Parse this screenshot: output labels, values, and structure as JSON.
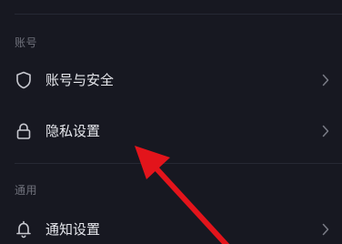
{
  "sections": [
    {
      "header": "账号",
      "items": [
        {
          "label": "账号与安全",
          "icon": "shield-icon"
        },
        {
          "label": "隐私设置",
          "icon": "lock-icon"
        }
      ]
    },
    {
      "header": "通用",
      "items": [
        {
          "label": "通知设置",
          "icon": "bell-icon"
        }
      ]
    }
  ],
  "colors": {
    "background": "#171821",
    "divider": "#262834",
    "header_text": "#6f717b",
    "item_text": "#e6e7ec",
    "icon": "#c9cad1",
    "chevron": "#7a7c86",
    "annotation_arrow": "#e3141b"
  }
}
